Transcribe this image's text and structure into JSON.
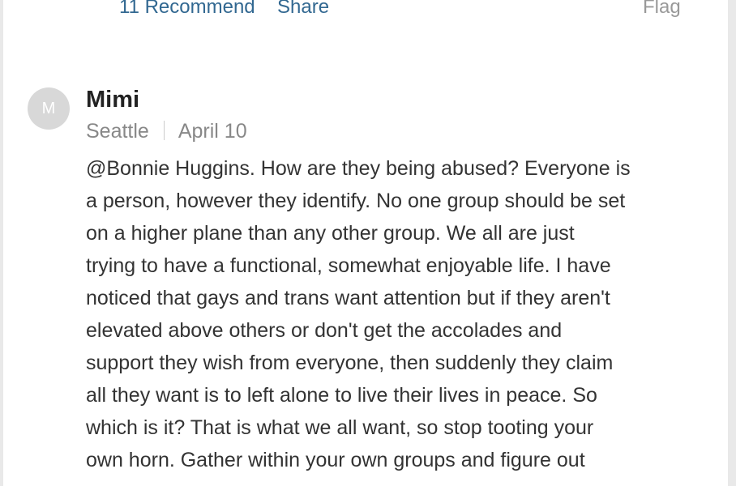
{
  "previous_comment_actions": {
    "recommend_label": "11 Recommend",
    "share_label": "Share",
    "flag_label": "Flag"
  },
  "comment": {
    "avatar_initial": "M",
    "author": "Mimi",
    "location": "Seattle",
    "date": "April 10",
    "body_lines": [
      "@Bonnie Huggins. How are they being abused?  Everyone is",
      "a person, however they identify.  No one group should be set",
      "on a higher plane than any other group.  We all are just",
      "trying to have a functional, somewhat enjoyable life.  I have",
      "noticed that gays and trans want attention but if they aren't",
      "elevated above others or don't get the accolades and",
      "support they wish from everyone, then suddenly they claim",
      "all they want is to left alone to live their lives in peace.  So",
      "which is it?  That is what we all want, so stop tooting your",
      "own horn.  Gather within your own groups and figure out"
    ]
  }
}
